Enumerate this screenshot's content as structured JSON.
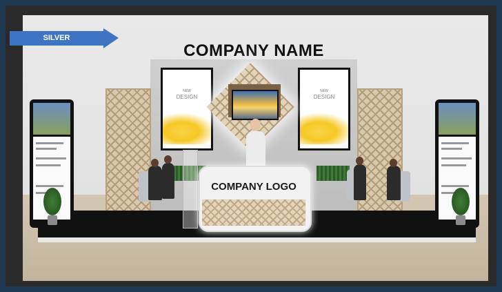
{
  "badge": {
    "label": "SILVER",
    "color": "#3e74c4"
  },
  "booth": {
    "header_text": "COMPANY NAME",
    "counter_text": "COMPANY LOGO",
    "poster_left": {
      "line1": "NEW",
      "line2": "DESIGN"
    },
    "poster_right": {
      "line1": "NEW",
      "line2": "DESIGN"
    }
  },
  "colors": {
    "frame": "#1e3951",
    "backwall": "#c7c7c7",
    "lattice": "#d8c8ad",
    "platform": "#111111"
  }
}
